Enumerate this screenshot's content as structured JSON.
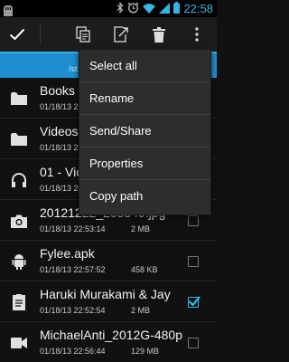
{
  "status_bar": {
    "time": "22:58",
    "icons": [
      "sd-card-icon",
      "bluetooth-icon",
      "alarm-icon",
      "wifi-icon",
      "signal-icon",
      "battery-icon"
    ]
  },
  "action_bar": {
    "icons": [
      "checkmark-icon",
      "copy-icon",
      "move-icon",
      "delete-icon",
      "overflow-menu-icon"
    ]
  },
  "path_bar": {
    "path": "/st"
  },
  "files": [
    {
      "name": "Books",
      "date": "01/18/13 22",
      "size": "",
      "icon": "folder-icon",
      "checked": false
    },
    {
      "name": "Videos",
      "date": "01/18/13 22",
      "size": "",
      "icon": "folder-icon",
      "checked": false
    },
    {
      "name": "01 - Vic",
      "date": "01/18/13 22",
      "size": "",
      "icon": "headphones-icon",
      "checked": false
    },
    {
      "name": "20121222_203349.jpg",
      "date": "01/18/13 22:53:14",
      "size": "2 MB",
      "icon": "camera-icon",
      "checked": false
    },
    {
      "name": "Fylee.apk",
      "date": "01/18/13 22:57:52",
      "size": "458 KB",
      "icon": "android-icon",
      "checked": false
    },
    {
      "name": "Haruki Murakami & Jay",
      "date": "01/18/13 22:52:54",
      "size": "2 MB",
      "icon": "document-icon",
      "checked": true
    },
    {
      "name": "MichaelAnti_2012G-480p",
      "date": "01/18/13 22:56:44",
      "size": "129 MB",
      "icon": "video-icon",
      "checked": false
    }
  ],
  "popup_menu": {
    "items": [
      "Select all",
      "Rename",
      "Send/Share",
      "Properties",
      "Copy path"
    ]
  },
  "colors": {
    "accent": "#33b5e5",
    "path_bar": "#1f8fcf",
    "background": "#111111",
    "menu": "#2d2d2d"
  }
}
